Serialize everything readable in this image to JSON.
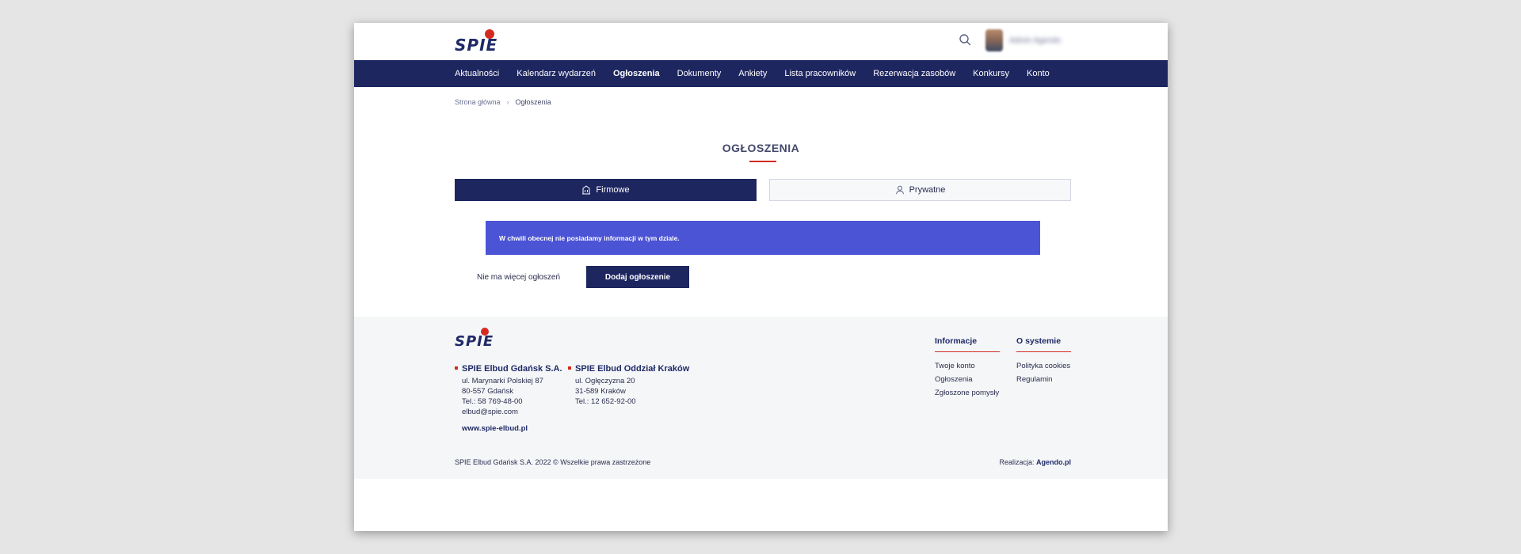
{
  "header": {
    "brand": "SPIE",
    "user_name": "Admin Agendo"
  },
  "nav": {
    "items": [
      {
        "label": "Aktualności"
      },
      {
        "label": "Kalendarz wydarzeń"
      },
      {
        "label": "Ogłoszenia"
      },
      {
        "label": "Dokumenty"
      },
      {
        "label": "Ankiety"
      },
      {
        "label": "Lista pracowników"
      },
      {
        "label": "Rezerwacja zasobów"
      },
      {
        "label": "Konkursy"
      },
      {
        "label": "Konto"
      }
    ]
  },
  "breadcrumb": {
    "home": "Strona główna",
    "separator": "›",
    "current": "Ogłoszenia"
  },
  "page": {
    "title": "OGŁOSZENIA",
    "tabs": {
      "company": "Firmowe",
      "private": "Prywatne"
    },
    "info_message": "W chwili obecnej nie posiadamy informacji w tym dziale.",
    "no_more": "Nie ma więcej ogłoszeń",
    "add_button": "Dodaj ogłoszenie"
  },
  "footer": {
    "brand": "SPIE",
    "companies": [
      {
        "name": "SPIE Elbud Gdańsk S.A.",
        "street": "ul. Marynarki Polskiej 87",
        "city": "80-557 Gdańsk",
        "phone": "Tel.: 58 769-48-00",
        "email": "elbud@spie.com"
      },
      {
        "name": "SPIE Elbud Oddział Kraków",
        "street": "ul. Ogłęczyzna 20",
        "city": "31-589 Kraków",
        "phone": "Tel.: 12 652-92-00"
      }
    ],
    "website": "www.spie-elbud.pl",
    "info_col": {
      "title": "Informacje",
      "links": [
        "Twoje konto",
        "Ogłoszenia",
        "Zgłoszone pomysły"
      ]
    },
    "system_col": {
      "title": "O systemie",
      "links": [
        "Polityka cookies",
        "Regulamin"
      ]
    },
    "copyright": "SPIE Elbud Gdańsk S.A. 2022 © Wszelkie prawa zastrzeżone",
    "realization_label": "Realizacja:",
    "realization_link": "Agendo.pl"
  },
  "colors": {
    "navy": "#1e2660",
    "accent_red": "#d42a20",
    "info_blue": "#4b54d4"
  }
}
